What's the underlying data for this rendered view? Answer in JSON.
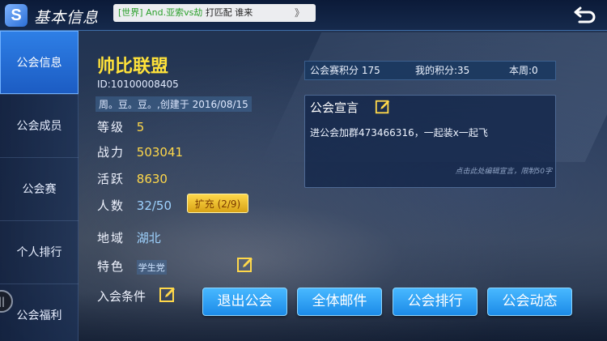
{
  "header": {
    "title": "基本信息",
    "broadcast": {
      "channel": "[世界]",
      "name": "And.亚索vs劫",
      "message": "打匹配  谁来",
      "more": "》"
    }
  },
  "sidebar": {
    "items": [
      {
        "label": "公会信息",
        "active": true
      },
      {
        "label": "公会成员",
        "active": false
      },
      {
        "label": "公会赛",
        "active": false
      },
      {
        "label": "个人排行",
        "active": false
      },
      {
        "label": "公会福利",
        "active": false
      }
    ]
  },
  "guild": {
    "name": "帅比联盟",
    "id": "ID:10100008405",
    "creator": "周。豆。豆。,创建于 2016/08/15",
    "level_label": "等级",
    "level": "5",
    "power_label": "战力",
    "power": "503041",
    "activity_label": "活跃",
    "activity": "8630",
    "members_label": "人数",
    "members": "32/50",
    "expand_label": "扩充 (2/9)",
    "region_label": "地域",
    "region": "湖北",
    "feature_label": "特色",
    "feature": "学生党",
    "join_label": "入会条件"
  },
  "scores": {
    "guild_score": "公会赛积分 175",
    "my_score": "我的积分:35",
    "this_week": "本周:0"
  },
  "manifesto": {
    "title": "公会宣言",
    "text": "进公会加群473466316，一起装x一起飞",
    "hint": "点击此处编辑宣言，限制50字"
  },
  "actions": {
    "leave": "退出公会",
    "mail": "全体邮件",
    "rank": "公会排行",
    "news": "公会动态"
  },
  "colors": {
    "accent": "#ffd84a",
    "button": "#1c8be8",
    "active_tab": "#2e7fe6"
  }
}
